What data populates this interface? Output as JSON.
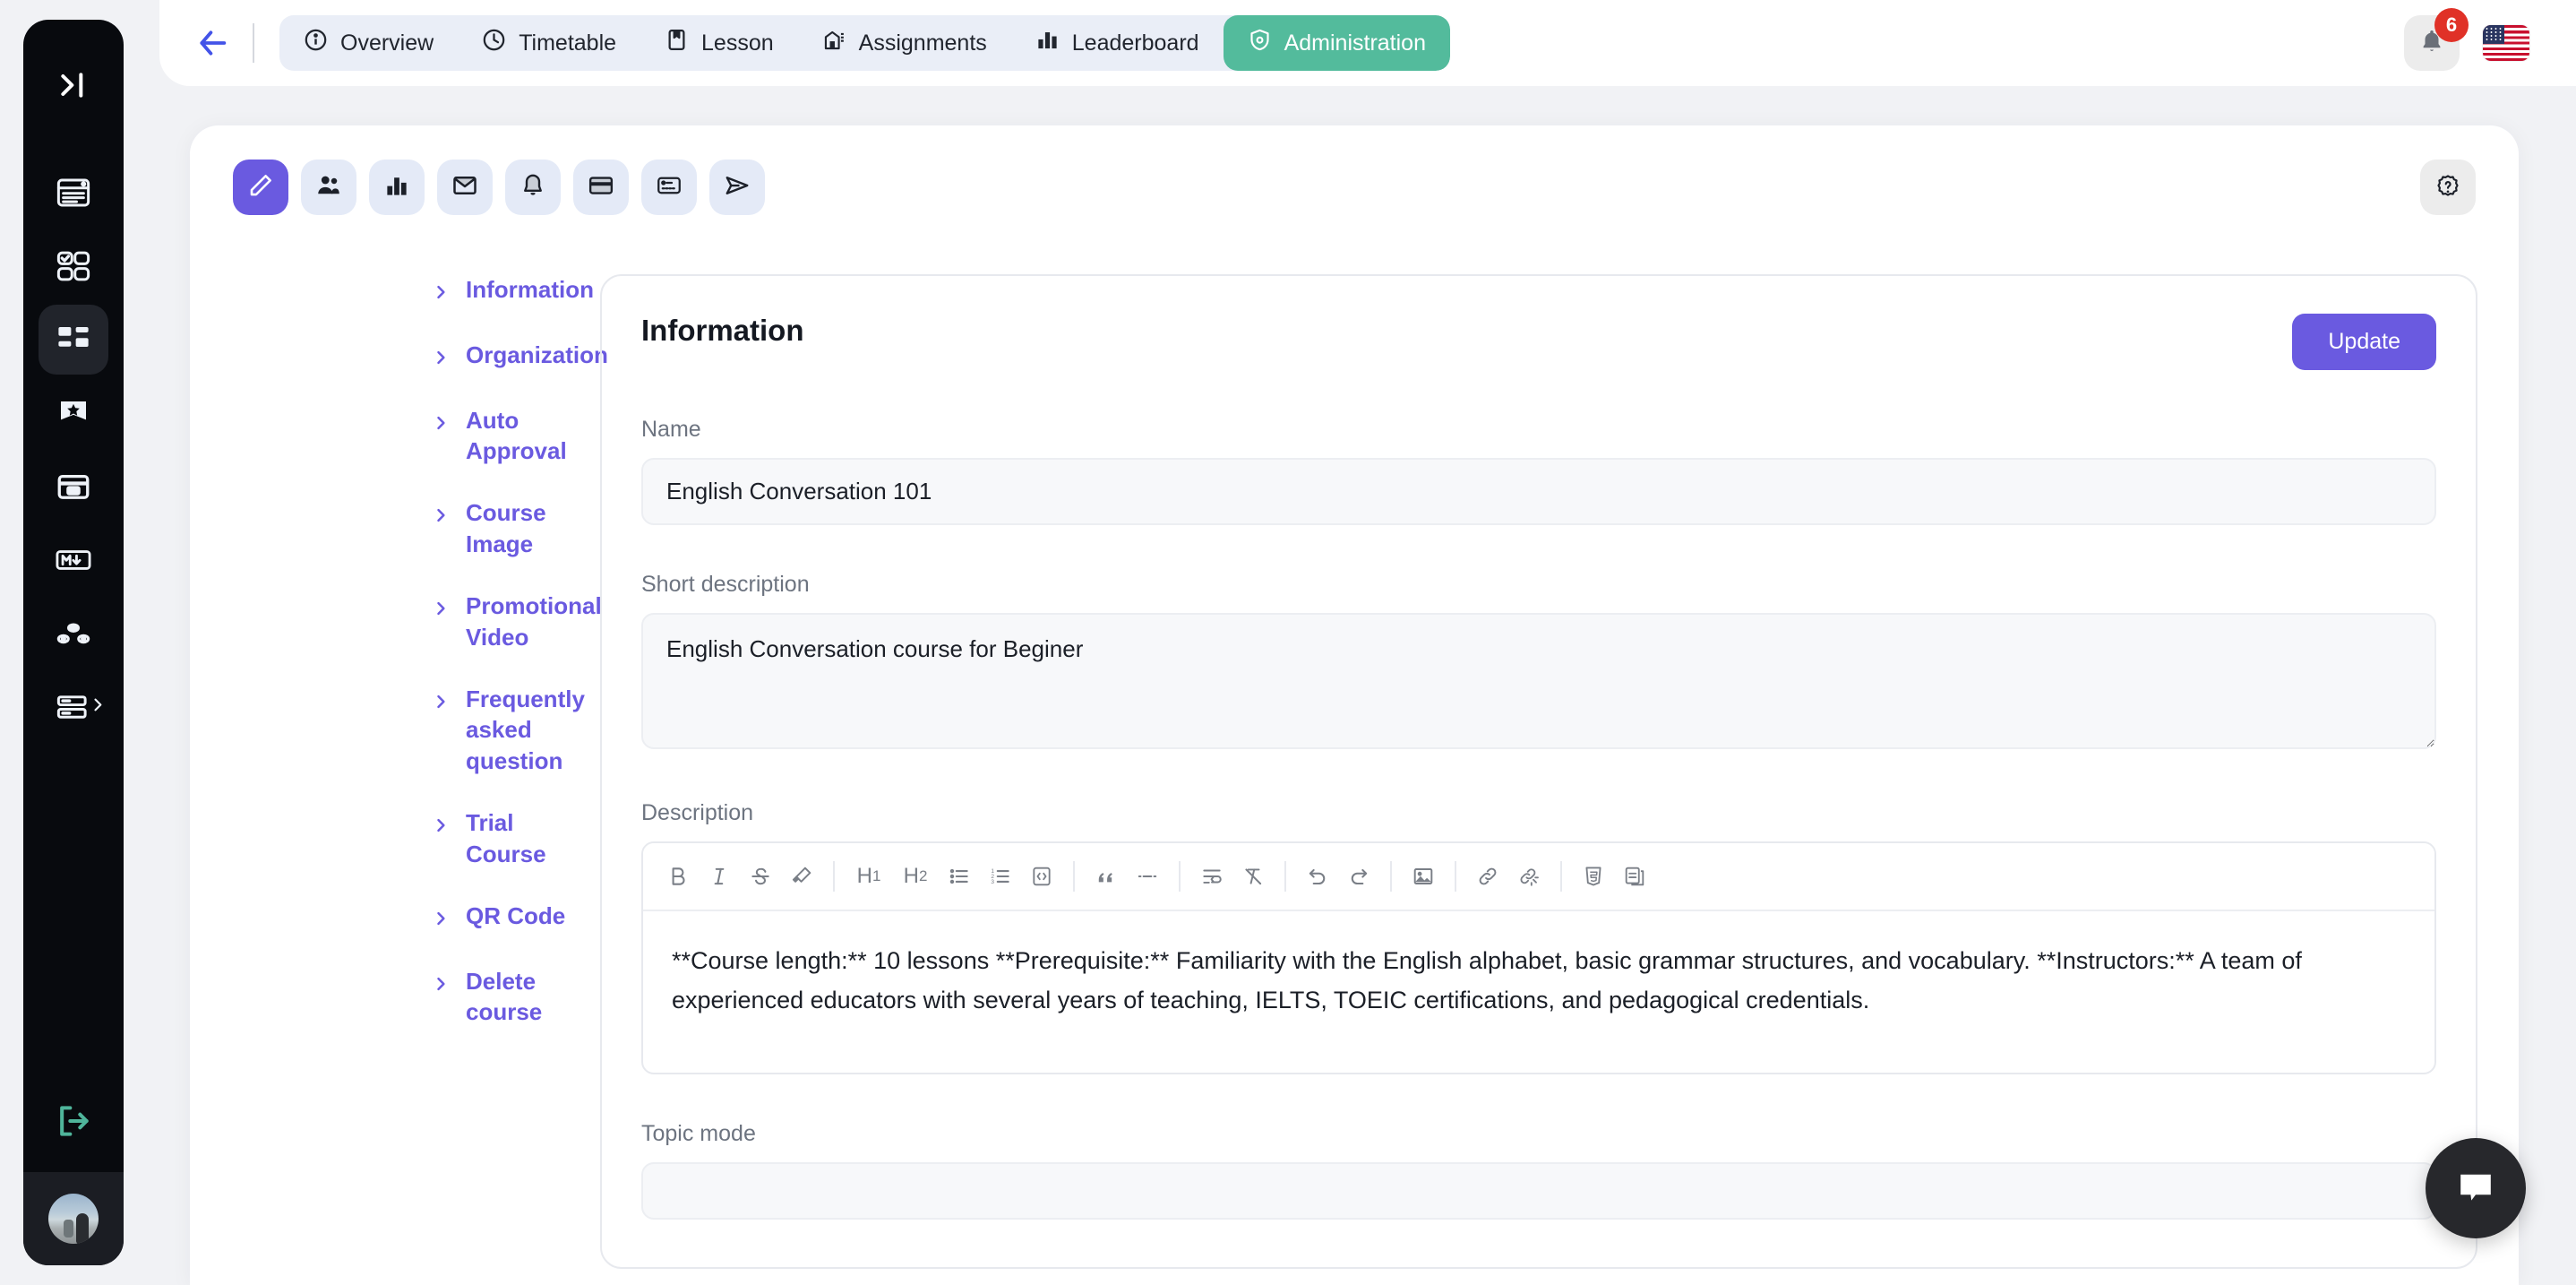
{
  "sidebar": {
    "toggle_icon": "expand-sidebar-icon",
    "items": [
      {
        "icon": "card-list-icon",
        "name": "sidebar-item-feed",
        "active": false,
        "has_chevron": false
      },
      {
        "icon": "tasks-grid-icon",
        "name": "sidebar-item-tasks",
        "active": false,
        "has_chevron": false
      },
      {
        "icon": "dashboard-icon",
        "name": "sidebar-item-dashboard",
        "active": true,
        "has_chevron": false
      },
      {
        "icon": "bookmark-icon",
        "name": "sidebar-item-bookmarks",
        "active": false,
        "has_chevron": false
      },
      {
        "icon": "calendar-icon",
        "name": "sidebar-item-calendar",
        "active": false,
        "has_chevron": false
      },
      {
        "icon": "markdown-icon",
        "name": "sidebar-item-markdown",
        "active": false,
        "has_chevron": false
      },
      {
        "icon": "network-icon",
        "name": "sidebar-item-network",
        "active": false,
        "has_chevron": false
      },
      {
        "icon": "list-detail-icon",
        "name": "sidebar-item-more",
        "active": false,
        "has_chevron": true
      }
    ],
    "logout_icon": "logout-icon",
    "avatar_name": "user-avatar"
  },
  "topbar": {
    "back_icon": "arrow-left-icon",
    "tabs": [
      {
        "label": "Overview",
        "icon": "info-circle-icon",
        "active": false
      },
      {
        "label": "Timetable",
        "icon": "clock-icon",
        "active": false
      },
      {
        "label": "Lesson",
        "icon": "book-icon",
        "active": false
      },
      {
        "label": "Assignments",
        "icon": "assignment-icon",
        "active": false
      },
      {
        "label": "Leaderboard",
        "icon": "bar-chart-icon",
        "active": false
      },
      {
        "label": "Administration",
        "icon": "shield-gear-icon",
        "active": true
      }
    ],
    "notification_count": "6",
    "notification_icon": "bell-icon",
    "language_flag": "us-flag-icon",
    "accent_color": "#53bb9c"
  },
  "panel": {
    "mini_tabs": [
      {
        "icon": "pencil-icon",
        "name": "tab-edit",
        "active": true
      },
      {
        "icon": "users-icon",
        "name": "tab-members",
        "active": false
      },
      {
        "icon": "bar-chart-icon",
        "name": "tab-statistics",
        "active": false
      },
      {
        "icon": "mail-icon",
        "name": "tab-mail",
        "active": false
      },
      {
        "icon": "bell-icon",
        "name": "tab-notifications",
        "active": false
      },
      {
        "icon": "credit-card-icon",
        "name": "tab-payment",
        "active": false
      },
      {
        "icon": "id-card-icon",
        "name": "tab-certificate",
        "active": false
      },
      {
        "icon": "send-icon",
        "name": "tab-send",
        "active": false
      }
    ],
    "help_icon": "help-badge-icon",
    "accordion": [
      "Information",
      "Organization",
      "Auto Approval",
      "Course Image",
      "Promotional Video",
      "Frequently asked question",
      "Trial Course",
      "QR Code",
      "Delete course"
    ],
    "accent_color": "#6a5ae0"
  },
  "form": {
    "title": "Information",
    "update_label": "Update",
    "name_label": "Name",
    "name_value": "English Conversation 101",
    "name_placeholder": "Name",
    "short_description_label": "Short description",
    "short_description_value": "English Conversation course for Beginer",
    "short_description_placeholder": "Short description",
    "description_label": "Description",
    "description_value": "**Course length:** 10 lessons **Prerequisite:** Familiarity with the English alphabet, basic grammar structures, and vocabulary. **Instructors:** A team of experienced educators with several years of teaching, IELTS, TOEIC certifications, and pedagogical credentials.",
    "topic_mode_label": "Topic mode",
    "toolbar": [
      {
        "icon": "bold-icon",
        "label": "B"
      },
      {
        "icon": "italic-icon",
        "label": "I"
      },
      {
        "icon": "strikethrough-icon",
        "label": "S"
      },
      {
        "icon": "highlight-pen-icon",
        "label": ""
      },
      {
        "icon": "separator",
        "label": ""
      },
      {
        "icon": "heading-1-icon",
        "label": "H1"
      },
      {
        "icon": "heading-2-icon",
        "label": "H2"
      },
      {
        "icon": "bullet-list-icon",
        "label": ""
      },
      {
        "icon": "ordered-list-icon",
        "label": ""
      },
      {
        "icon": "code-block-icon",
        "label": ""
      },
      {
        "icon": "separator",
        "label": ""
      },
      {
        "icon": "blockquote-icon",
        "label": ""
      },
      {
        "icon": "horizontal-rule-icon",
        "label": ""
      },
      {
        "icon": "separator",
        "label": ""
      },
      {
        "icon": "hard-break-icon",
        "label": ""
      },
      {
        "icon": "clear-format-icon",
        "label": ""
      },
      {
        "icon": "separator",
        "label": ""
      },
      {
        "icon": "undo-icon",
        "label": ""
      },
      {
        "icon": "redo-icon",
        "label": ""
      },
      {
        "icon": "separator",
        "label": ""
      },
      {
        "icon": "image-icon",
        "label": ""
      },
      {
        "icon": "separator",
        "label": ""
      },
      {
        "icon": "link-icon",
        "label": ""
      },
      {
        "icon": "unlink-icon",
        "label": ""
      },
      {
        "icon": "separator",
        "label": ""
      },
      {
        "icon": "html5-icon",
        "label": ""
      },
      {
        "icon": "duplicate-icon",
        "label": ""
      }
    ]
  },
  "chat": {
    "icon": "chat-bubble-icon"
  }
}
